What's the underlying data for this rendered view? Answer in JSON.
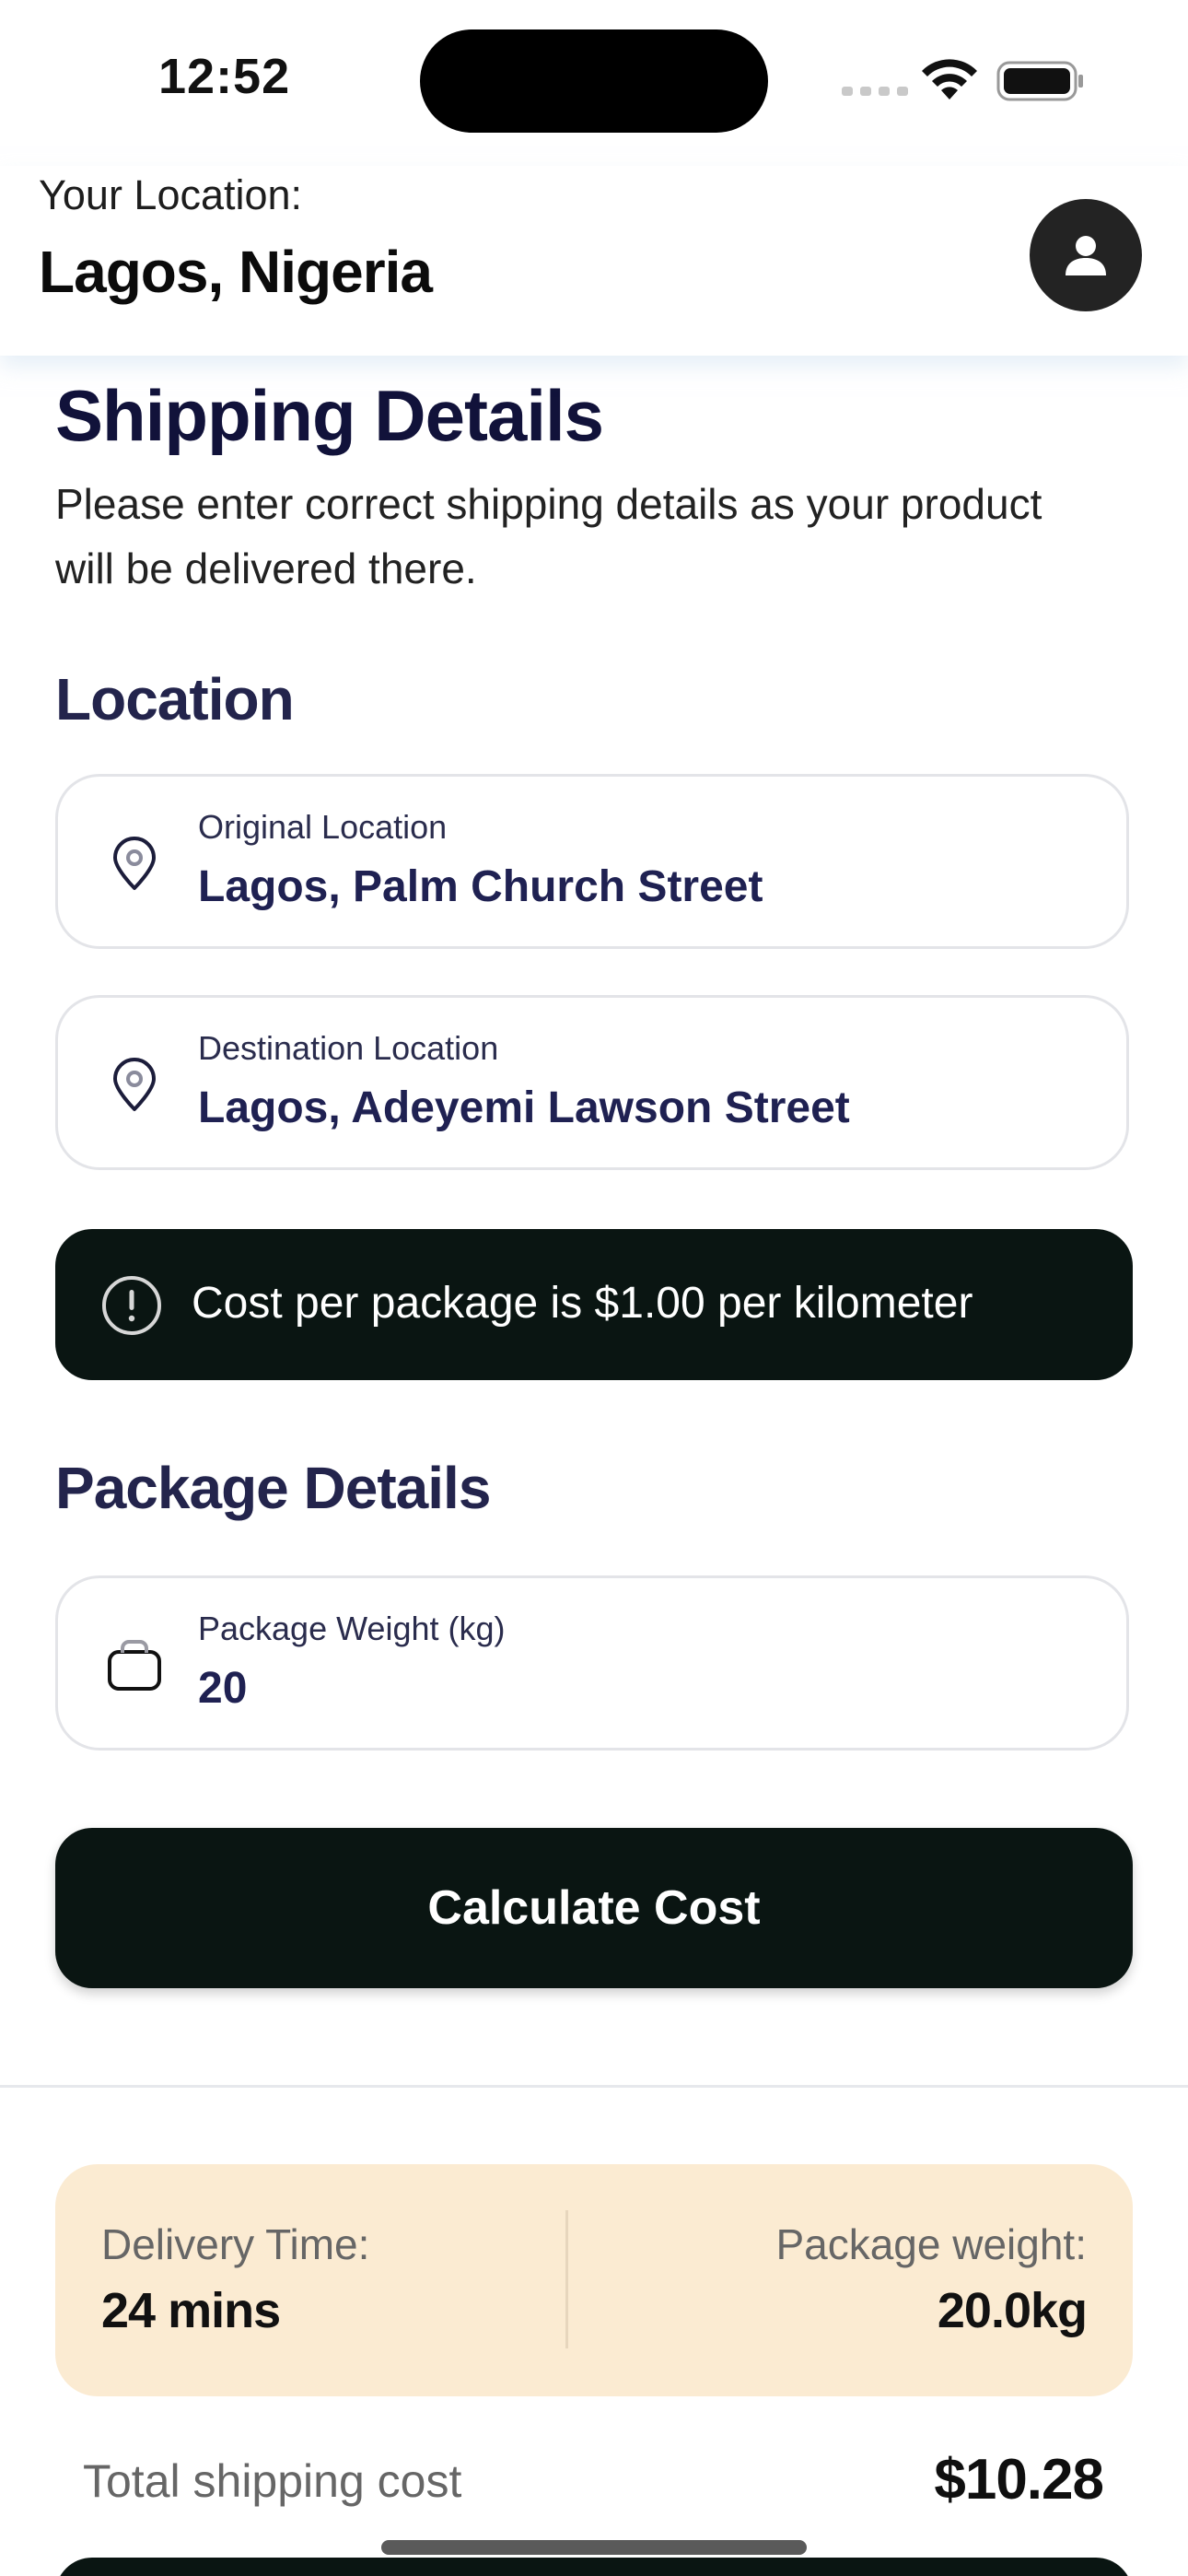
{
  "status_bar": {
    "time": "12:52",
    "icons": [
      "signal-icon",
      "wifi-icon",
      "battery-icon"
    ]
  },
  "header": {
    "location_label": "Your Location:",
    "location_value": "Lagos, Nigeria",
    "avatar_icon": "user-icon"
  },
  "main": {
    "title": "Shipping Details",
    "subtitle": "Please enter correct shipping details as your product will be delivered there.",
    "location_section": {
      "title": "Location",
      "origin": {
        "label": "Original Location",
        "value": "Lagos, Palm Church Street",
        "icon": "location-pin-icon"
      },
      "destination": {
        "label": "Destination Location",
        "value": "Lagos, Adeyemi Lawson Street",
        "icon": "location-pin-icon"
      }
    },
    "notice": {
      "icon": "info-icon",
      "text": "Cost per package is $1.00 per kilometer"
    },
    "package_section": {
      "title": "Package Details",
      "weight": {
        "label": "Package Weight (kg)",
        "value": "20",
        "icon": "bag-icon"
      }
    },
    "calculate_button": "Calculate Cost"
  },
  "summary": {
    "delivery_time_label": "Delivery Time:",
    "delivery_time_value": "24 mins",
    "package_weight_label": "Package weight:",
    "package_weight_value": "20.0kg",
    "total_label": "Total shipping cost",
    "total_value": "$10.28"
  },
  "colors": {
    "primary_dark": "#0a1512",
    "heading_navy": "#11123a",
    "summary_bg": "#fbebd2",
    "field_border": "#e3e4e8"
  }
}
